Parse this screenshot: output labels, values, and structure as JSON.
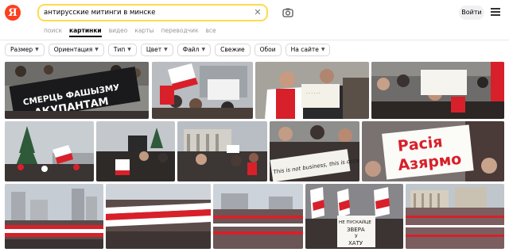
{
  "header": {
    "logo": "Я",
    "search_value": "антирусские митинги в минске",
    "login_label": "Войти"
  },
  "tabs": [
    "поиск",
    "картинки",
    "видео",
    "карты",
    "переводчик",
    "все"
  ],
  "active_tab": "картинки",
  "filters": [
    {
      "label": "Размер",
      "has_chevron": true
    },
    {
      "label": "Ориентация",
      "has_chevron": true
    },
    {
      "label": "Тип",
      "has_chevron": true
    },
    {
      "label": "Цвет",
      "has_chevron": true
    },
    {
      "label": "Файл",
      "has_chevron": true
    },
    {
      "label": "Свежие",
      "has_chevron": false
    },
    {
      "label": "Обои",
      "has_chevron": false
    },
    {
      "label": "На сайте",
      "has_chevron": true
    }
  ],
  "image_captions": {
    "banner_1_line1": "СМЕРЦЬ ФАШЫЗМУ",
    "banner_1_line2": "АКУПАНТАМ",
    "sign_1": "This is not business, this is occupation",
    "sign_2_line1": "Расія",
    "sign_2_line2": "Азярмо",
    "sign_3_line1": "НЕ ПУСКАЙЦЕ",
    "sign_3_line2": "ЗВЕРА",
    "sign_3_line3": "У",
    "sign_3_line4": "ХАТУ"
  },
  "colors": {
    "accent": "#ffdb4d",
    "logo": "#fc3f1d",
    "flag_red": "#d8202a",
    "flag_white": "#ffffff"
  }
}
